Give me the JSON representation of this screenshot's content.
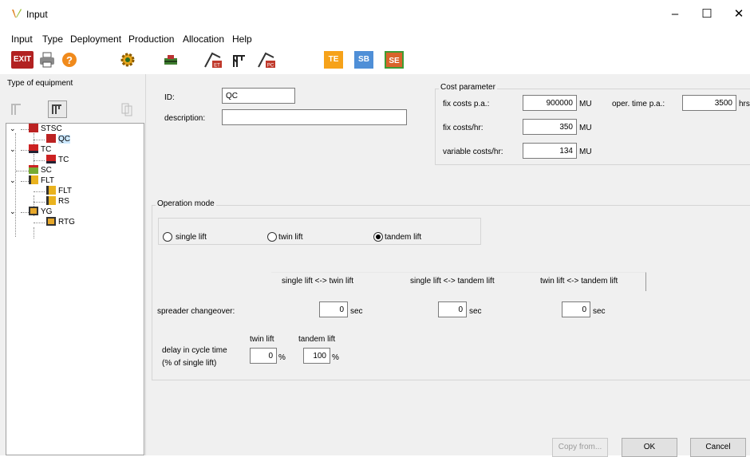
{
  "window": {
    "title": "Input",
    "minimize": "–",
    "maximize": "☐",
    "close": "✕"
  },
  "menu": [
    "Input",
    "Type",
    "Deployment",
    "Production",
    "Allocation",
    "Help"
  ],
  "toolbar": {
    "exit": "EXIT",
    "te": "TE",
    "sb": "SB",
    "se": "SE",
    "et": "ET",
    "pc": "PC"
  },
  "left": {
    "title": "Type of equipment",
    "tree": [
      {
        "label": "STSC",
        "level": 0,
        "expanded": true
      },
      {
        "label": "QC",
        "level": 1,
        "selected": true
      },
      {
        "label": "TC",
        "level": 0,
        "expanded": true
      },
      {
        "label": "TC",
        "level": 1
      },
      {
        "label": "SC",
        "level": 0
      },
      {
        "label": "FLT",
        "level": 0,
        "expanded": true
      },
      {
        "label": "FLT",
        "level": 1
      },
      {
        "label": "RS",
        "level": 1
      },
      {
        "label": "YG",
        "level": 0,
        "expanded": true
      },
      {
        "label": "RTG",
        "level": 1
      }
    ]
  },
  "form": {
    "id_label": "ID:",
    "id_value": "QC",
    "desc_label": "description:",
    "desc_value": "",
    "cost": {
      "title": "Cost parameter",
      "fix_pa_label": "fix costs p.a.:",
      "fix_pa_value": "900000",
      "fix_pa_unit": "MU",
      "oper_label": "oper. time p.a.:",
      "oper_value": "3500",
      "oper_unit": "hrs",
      "fix_hr_label": "fix costs/hr:",
      "fix_hr_value": "350",
      "fix_hr_unit": "MU",
      "var_hr_label": "variable costs/hr:",
      "var_hr_value": "134",
      "var_hr_unit": "MU"
    },
    "operation": {
      "title": "Operation mode",
      "options": [
        "single lift",
        "twin lift",
        "tandem lift"
      ],
      "selected": "tandem lift"
    },
    "changeover": {
      "headers": [
        "single lift <-> twin lift",
        "single lift <-> tandem lift",
        "twin lift <-> tandem lift"
      ],
      "row_label": "spreader changeover:",
      "values": [
        "0",
        "0",
        "0"
      ],
      "unit": "sec"
    },
    "delay": {
      "label1": "delay in cycle time",
      "label2": "(% of single lift)",
      "twin_label": "twin lift",
      "tandem_label": "tandem lift",
      "twin_value": "0",
      "tandem_value": "100",
      "unit": "%"
    }
  },
  "buttons": {
    "copy_from": "Copy from...",
    "ok": "OK",
    "cancel": "Cancel"
  }
}
